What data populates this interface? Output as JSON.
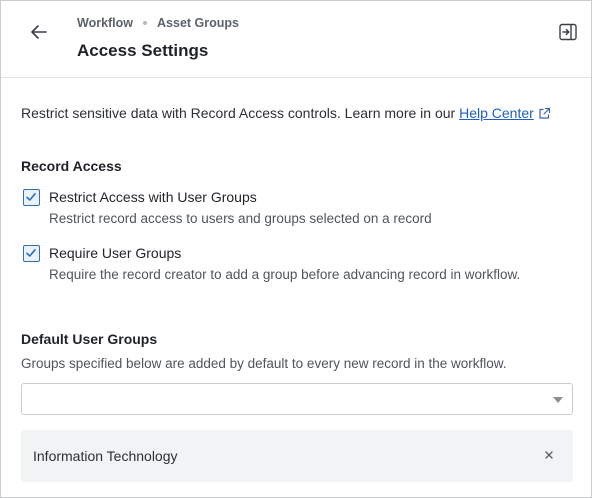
{
  "header": {
    "breadcrumb": [
      {
        "label": "Workflow"
      },
      {
        "label": "Asset Groups"
      }
    ],
    "title": "Access Settings",
    "icons": {
      "back": "arrow-left-icon",
      "collapse": "panel-collapse-icon"
    }
  },
  "intro": {
    "text": "Restrict sensitive data with Record Access controls. Learn more in our ",
    "link_label": "Help Center",
    "link_icon": "external-link-icon"
  },
  "record_access": {
    "title": "Record Access",
    "options": [
      {
        "label": "Restrict Access with User Groups",
        "description": "Restrict record access to users and groups selected on a record",
        "checked": true
      },
      {
        "label": "Require User Groups",
        "description": "Require the record creator to add a group before advancing record in workflow.",
        "checked": true
      }
    ]
  },
  "default_groups": {
    "title": "Default User Groups",
    "description": "Groups specified below are added by default to every new record in the workflow.",
    "select_value": "",
    "selected_groups": [
      {
        "label": "Information Technology"
      }
    ]
  },
  "colors": {
    "accent": "#2f6fb8",
    "link": "#1f5fbf",
    "chip_bg": "#f2f3f5"
  }
}
